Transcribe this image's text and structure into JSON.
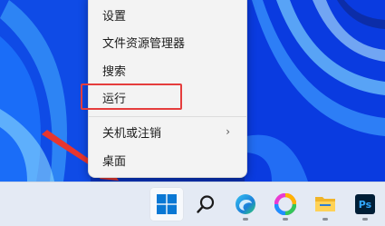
{
  "context_menu": {
    "items": [
      {
        "label": "设置"
      },
      {
        "label": "文件资源管理器"
      },
      {
        "label": "搜索"
      },
      {
        "label": "运行"
      },
      {
        "label": "关机或注销",
        "submenu_icon": "chevron-right-icon",
        "submenu_glyph": "›"
      },
      {
        "label": "桌面"
      }
    ],
    "highlighted_item": "运行"
  },
  "taskbar": {
    "icons": [
      {
        "name": "start-icon"
      },
      {
        "name": "search-icon"
      },
      {
        "name": "edge-icon"
      },
      {
        "name": "color-app-icon"
      },
      {
        "name": "file-explorer-icon"
      },
      {
        "name": "photoshop-icon",
        "text": "Ps"
      }
    ]
  },
  "colors": {
    "highlight_box": "#e53d3d",
    "annotation_arrow": "#e8362e",
    "taskbar_bg": "#e4eaf4",
    "menu_bg": "#f3f3f3"
  }
}
